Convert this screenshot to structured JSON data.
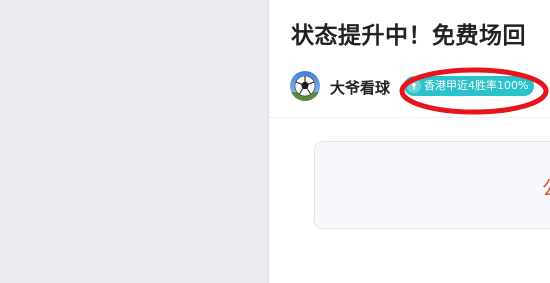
{
  "article": {
    "title": "状态提升中！免费场回",
    "author": "大爷看球",
    "badge": "香港甲近4胜率100%",
    "content_preview": "公"
  },
  "colors": {
    "left_panel": "#e9ebef",
    "badge_bg": "#2cc2c9",
    "annotation_circle": "#e8141c",
    "content_accent": "#d9582a"
  },
  "icons": {
    "avatar": "soccer-ball-avatar",
    "badge": "up-arrow-icon"
  }
}
